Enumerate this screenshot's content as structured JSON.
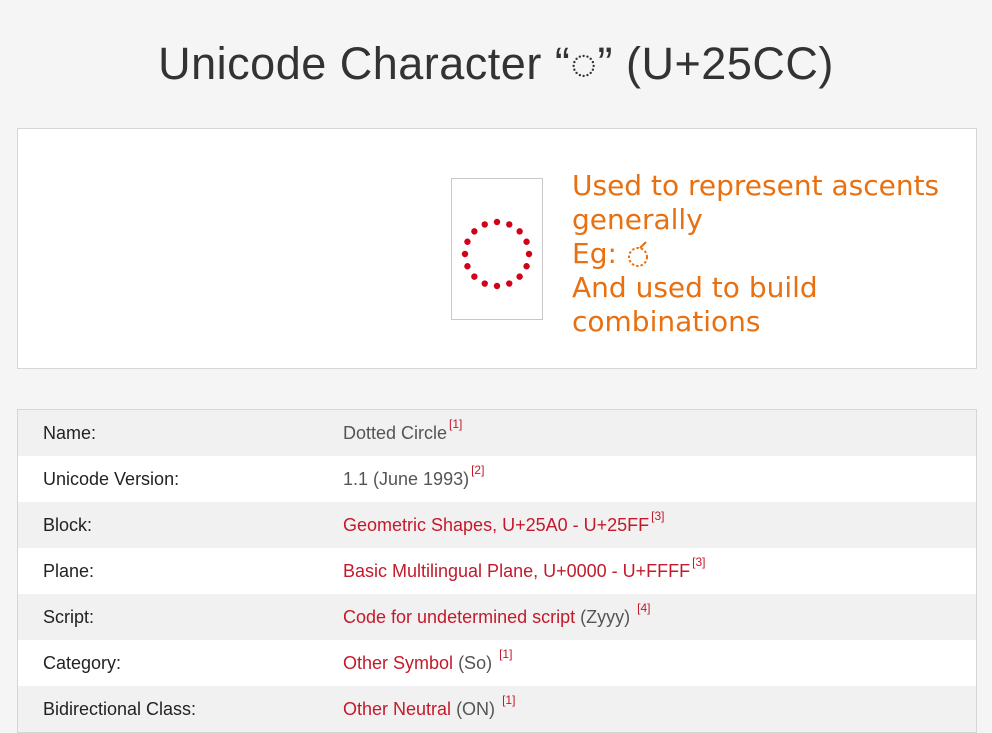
{
  "page": {
    "title": "Unicode Character “◌” (U+25CC)"
  },
  "preview": {
    "note_lines": [
      "Used to represent ascents",
      "generally",
      "Eg: ",
      "And used to build",
      "combinations"
    ],
    "glyph_color": "#d0021b",
    "note_color": "#e87010"
  },
  "properties": {
    "rows": [
      {
        "label": "Name:",
        "value": "Dotted Circle",
        "ref": "[1]"
      },
      {
        "label": "Unicode Version:",
        "value": "1.1 (June 1993)",
        "ref": "[2]"
      },
      {
        "label": "Block:",
        "link": "Geometric Shapes, U+25A0 - U+25FF",
        "ref": "[3]"
      },
      {
        "label": "Plane:",
        "link": "Basic Multilingual Plane, U+0000 - U+FFFF",
        "ref": "[3]"
      },
      {
        "label": "Script:",
        "link": "Code for undetermined script",
        "extra": "(Zyyy)",
        "ref": "[4]"
      },
      {
        "label": "Category:",
        "link": "Other Symbol",
        "extra": "(So)",
        "ref": "[1]"
      },
      {
        "label": "Bidirectional Class:",
        "link": "Other Neutral",
        "extra": "(ON)",
        "ref": "[1]"
      }
    ]
  }
}
